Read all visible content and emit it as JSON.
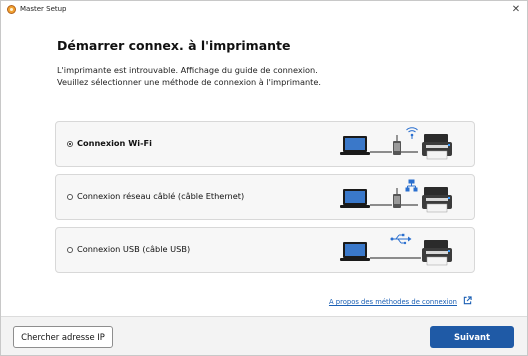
{
  "window": {
    "title": "Master Setup",
    "close_glyph": "✕"
  },
  "heading": "Démarrer connex. à l'imprimante",
  "description": {
    "line1": "L'imprimante est introuvable. Affichage du guide de connexion.",
    "line2": "Veuillez sélectionner une méthode de connexion à l'imprimante."
  },
  "options": [
    {
      "label": "Connexion Wi-Fi",
      "selected": true,
      "icons": [
        "laptop-icon",
        "router-icon",
        "wifi-signal-icon",
        "printer-icon"
      ]
    },
    {
      "label": "Connexion réseau câblé (câble Ethernet)",
      "selected": false,
      "icons": [
        "laptop-icon",
        "router-icon",
        "ethernet-icon",
        "printer-icon"
      ]
    },
    {
      "label": "Connexion USB (câble USB)",
      "selected": false,
      "icons": [
        "laptop-icon",
        "usb-icon",
        "printer-icon"
      ]
    }
  ],
  "about_link": "A propos des méthodes de connexion",
  "footer": {
    "search_ip_label": "Chercher adresse IP",
    "next_label": "Suivant"
  },
  "colors": {
    "primary": "#1f5aa6",
    "link": "#1a5fb4",
    "option_bg": "#f7f7f7"
  }
}
